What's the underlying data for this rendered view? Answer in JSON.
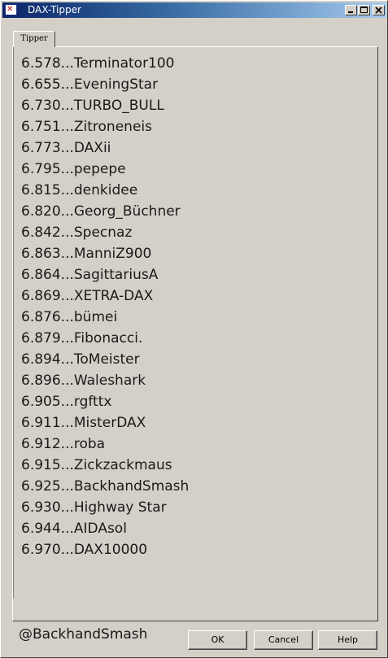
{
  "window": {
    "title": "DAX-Tipper",
    "controls": {
      "minimize": "_",
      "maximize": "□",
      "close": "×"
    }
  },
  "tab": {
    "label": "Tipper"
  },
  "tips": [
    "6.578...Terminator100",
    "6.655...EveningStar",
    "6.730...TURBO_BULL",
    "6.751...Zitroneneis",
    "6.773...DAXii",
    "6.795...pepepe",
    "6.815...denkidee",
    "6.820...Georg_Büchner",
    "6.842...Specnaz",
    "6.863...ManniZ900",
    "6.864...SagittariusA",
    "6.869...XETRA-DAX",
    "6.876...bümei",
    "6.879...Fibonacci.",
    "6.894...ToMeister",
    "6.896...Waleshark",
    "6.905...rgfttx",
    "6.911...MisterDAX",
    "6.912...roba",
    "6.915...Zickzackmaus",
    "6.925...BackhandSmash",
    "6.930...Highway Star",
    "6.944...AIDAsol",
    "6.970...DAX10000"
  ],
  "footer": {
    "user": "@BackhandSmash",
    "ok_label": "OK",
    "cancel_label": "Cancel",
    "help_label": "Help"
  }
}
